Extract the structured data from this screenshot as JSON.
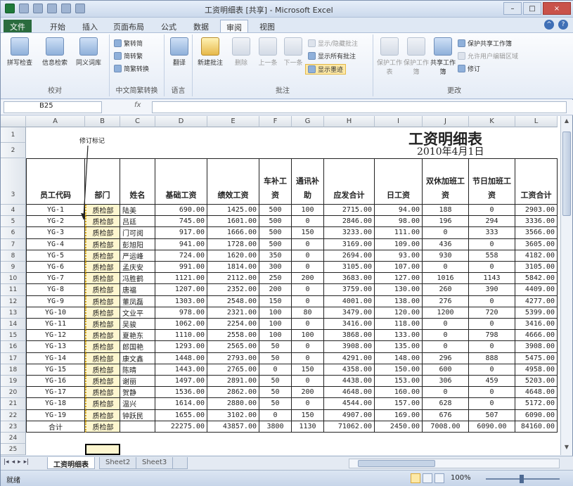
{
  "window": {
    "title": "工资明细表 [共享] - Microsoft Excel",
    "minimize": "–",
    "maximize": "□",
    "close": "×"
  },
  "ribbon_tabs": [
    "文件",
    "开始",
    "插入",
    "页面布局",
    "公式",
    "数据",
    "审阅",
    "视图"
  ],
  "active_tab": "审阅",
  "ribbon": {
    "proofing": {
      "label": "校对",
      "buttons": [
        "拼写检查",
        "信息检索",
        "同义词库"
      ]
    },
    "chinese": {
      "label": "中文简繁转换",
      "buttons": [
        "繁转简",
        "简转繁",
        "简繁转换"
      ]
    },
    "language": {
      "label": "语言",
      "buttons": [
        "翻译"
      ]
    },
    "comments": {
      "label": "批注",
      "buttons": [
        "新建批注",
        "删除",
        "上一条",
        "下一条"
      ],
      "side": [
        "显示/隐藏批注",
        "显示所有批注",
        "显示墨迹"
      ]
    },
    "changes": {
      "label": "更改",
      "buttons": [
        "保护工作表",
        "保护工作簿",
        "共享工作簿"
      ],
      "side": [
        "保护共享工作簿",
        "允许用户编辑区域",
        "修订"
      ]
    }
  },
  "formula_bar": {
    "name_box": "B25",
    "fx": "fx"
  },
  "columns": [
    "A",
    "B",
    "C",
    "D",
    "E",
    "F",
    "G",
    "H",
    "I",
    "J",
    "K",
    "L"
  ],
  "sheet": {
    "title": "工资明细表",
    "date": "2010年4月1日",
    "annotation": "修订标记",
    "headers": [
      "员工代码",
      "部门",
      "姓名",
      "基础工资",
      "绩效工资",
      "车补工资",
      "通讯补助",
      "应发合计",
      "日工资",
      "双休加班工资",
      "节日加班工资",
      "工资合计"
    ],
    "rows": [
      [
        "YG-1",
        "质检部",
        "陆美",
        "690.00",
        "1425.00",
        "500",
        "100",
        "2715.00",
        "94.00",
        "188",
        "0",
        "2903.00"
      ],
      [
        "YG-2",
        "质检部",
        "吕廷",
        "745.00",
        "1601.00",
        "500",
        "0",
        "2846.00",
        "98.00",
        "196",
        "294",
        "3336.00"
      ],
      [
        "YG-3",
        "质检部",
        "门可阅",
        "917.00",
        "1666.00",
        "500",
        "150",
        "3233.00",
        "111.00",
        "0",
        "333",
        "3566.00"
      ],
      [
        "YG-4",
        "质检部",
        "彭旭阳",
        "941.00",
        "1728.00",
        "500",
        "0",
        "3169.00",
        "109.00",
        "436",
        "0",
        "3605.00"
      ],
      [
        "YG-5",
        "质检部",
        "严运峰",
        "724.00",
        "1620.00",
        "350",
        "0",
        "2694.00",
        "93.00",
        "930",
        "558",
        "4182.00"
      ],
      [
        "YG-6",
        "质检部",
        "孟庆安",
        "991.00",
        "1814.00",
        "300",
        "0",
        "3105.00",
        "107.00",
        "0",
        "0",
        "3105.00"
      ],
      [
        "YG-7",
        "质检部",
        "冯胜鹤",
        "1121.00",
        "2112.00",
        "250",
        "200",
        "3683.00",
        "127.00",
        "1016",
        "1143",
        "5842.00"
      ],
      [
        "YG-8",
        "质检部",
        "唐福",
        "1207.00",
        "2352.00",
        "200",
        "0",
        "3759.00",
        "130.00",
        "260",
        "390",
        "4409.00"
      ],
      [
        "YG-9",
        "质检部",
        "董凤磊",
        "1303.00",
        "2548.00",
        "150",
        "0",
        "4001.00",
        "138.00",
        "276",
        "0",
        "4277.00"
      ],
      [
        "YG-10",
        "质检部",
        "文业平",
        "978.00",
        "2321.00",
        "100",
        "80",
        "3479.00",
        "120.00",
        "1200",
        "720",
        "5399.00"
      ],
      [
        "YG-11",
        "质检部",
        "吴骏",
        "1062.00",
        "2254.00",
        "100",
        "0",
        "3416.00",
        "118.00",
        "0",
        "0",
        "3416.00"
      ],
      [
        "YG-12",
        "质检部",
        "夏艳东",
        "1110.00",
        "2558.00",
        "100",
        "100",
        "3868.00",
        "133.00",
        "0",
        "798",
        "4666.00"
      ],
      [
        "YG-13",
        "质检部",
        "郎国艳",
        "1293.00",
        "2565.00",
        "50",
        "0",
        "3908.00",
        "135.00",
        "0",
        "0",
        "3908.00"
      ],
      [
        "YG-14",
        "质检部",
        "康文鑫",
        "1448.00",
        "2793.00",
        "50",
        "0",
        "4291.00",
        "148.00",
        "296",
        "888",
        "5475.00"
      ],
      [
        "YG-15",
        "质检部",
        "陈晴",
        "1443.00",
        "2765.00",
        "0",
        "150",
        "4358.00",
        "150.00",
        "600",
        "0",
        "4958.00"
      ],
      [
        "YG-16",
        "质检部",
        "谢丽",
        "1497.00",
        "2891.00",
        "50",
        "0",
        "4438.00",
        "153.00",
        "306",
        "459",
        "5203.00"
      ],
      [
        "YG-17",
        "质检部",
        "贺静",
        "1536.00",
        "2862.00",
        "50",
        "200",
        "4648.00",
        "160.00",
        "0",
        "0",
        "4648.00"
      ],
      [
        "YG-18",
        "质检部",
        "温兴",
        "1614.00",
        "2880.00",
        "50",
        "0",
        "4544.00",
        "157.00",
        "628",
        "0",
        "5172.00"
      ],
      [
        "YG-19",
        "质检部",
        "钟跃民",
        "1655.00",
        "3102.00",
        "0",
        "150",
        "4907.00",
        "169.00",
        "676",
        "507",
        "6090.00"
      ]
    ],
    "total": [
      "合计",
      "质检部",
      "",
      "22275.00",
      "43857.00",
      "3800",
      "1130",
      "71062.00",
      "2450.00",
      "7008.00",
      "6090.00",
      "84160.00"
    ],
    "row_numbers": [
      "1",
      "2",
      "3",
      "4",
      "5",
      "6",
      "7",
      "8",
      "9",
      "10",
      "11",
      "12",
      "13",
      "14",
      "15",
      "16",
      "17",
      "18",
      "19",
      "20",
      "21",
      "22",
      "23",
      "24",
      "25"
    ]
  },
  "sheet_tabs": [
    "工资明细表",
    "Sheet2",
    "Sheet3"
  ],
  "status": {
    "ready": "就绪",
    "zoom": "100%"
  }
}
